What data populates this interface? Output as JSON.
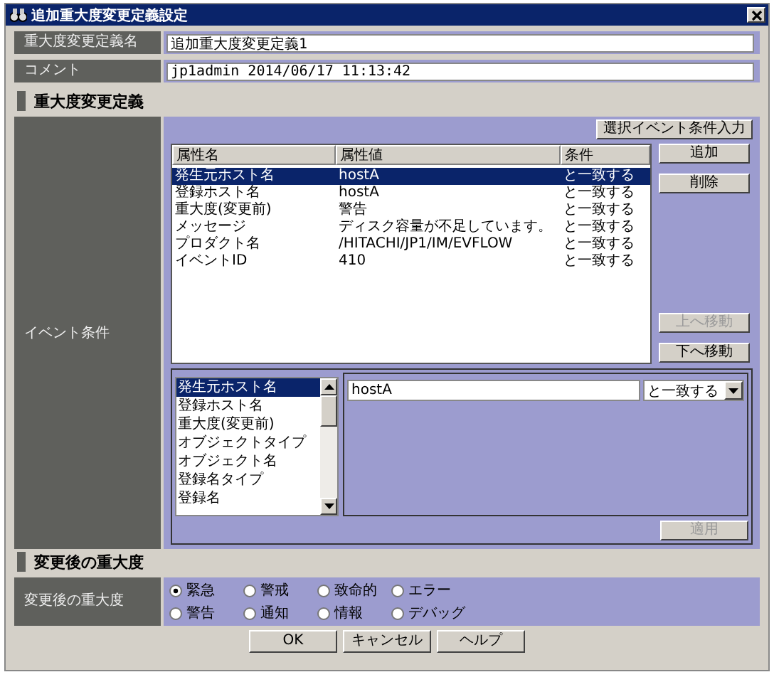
{
  "window": {
    "title": "追加重大度変更定義設定"
  },
  "fields": [
    {
      "label": "重大度変更定義名",
      "value": "追加重大度変更定義1"
    },
    {
      "label": "コメント",
      "value": "jp1admin 2014/06/17 11:13:42"
    }
  ],
  "definition_section": {
    "heading": "重大度変更定義",
    "label": "イベント条件",
    "input_button": "選択イベント条件入力",
    "table": {
      "columns": [
        "属性名",
        "属性値",
        "条件"
      ],
      "rows": [
        {
          "cells": [
            "発生元ホスト名",
            "hostA",
            "と一致する"
          ],
          "selected": true
        },
        {
          "cells": [
            "登録ホスト名",
            "hostA",
            "と一致する"
          ],
          "selected": false
        },
        {
          "cells": [
            "重大度(変更前)",
            "警告",
            "と一致する"
          ],
          "selected": false
        },
        {
          "cells": [
            "メッセージ",
            "ディスク容量が不足しています。",
            "と一致する"
          ],
          "selected": false
        },
        {
          "cells": [
            "プロダクト名",
            "/HITACHI/JP1/IM/EVFLOW",
            "と一致する"
          ],
          "selected": false
        },
        {
          "cells": [
            "イベントID",
            "410",
            "と一致する"
          ],
          "selected": false
        }
      ]
    },
    "side_buttons": [
      {
        "label": "追加",
        "disabled": false
      },
      {
        "label": "削除",
        "disabled": false
      },
      {
        "label": "上へ移動",
        "disabled": true
      },
      {
        "label": "下へ移動",
        "disabled": false
      }
    ],
    "attribute_list": {
      "items": [
        {
          "label": "発生元ホスト名",
          "selected": true
        },
        {
          "label": "登録ホスト名",
          "selected": false
        },
        {
          "label": "重大度(変更前)",
          "selected": false
        },
        {
          "label": "オブジェクトタイプ",
          "selected": false
        },
        {
          "label": "オブジェクト名",
          "selected": false
        },
        {
          "label": "登録名タイプ",
          "selected": false
        },
        {
          "label": "登録名",
          "selected": false
        }
      ]
    },
    "value_field": {
      "value": "hostA"
    },
    "condition_select": {
      "value": "と一致する"
    },
    "apply_button": {
      "label": "適用",
      "disabled": true
    }
  },
  "severity_section": {
    "heading": "変更後の重大度",
    "label": "変更後の重大度",
    "options": [
      {
        "label": "緊急",
        "selected": true
      },
      {
        "label": "警戒",
        "selected": false
      },
      {
        "label": "致命的",
        "selected": false
      },
      {
        "label": "エラー",
        "selected": false
      },
      {
        "label": "警告",
        "selected": false
      },
      {
        "label": "通知",
        "selected": false
      },
      {
        "label": "情報",
        "selected": false
      },
      {
        "label": "デバッグ",
        "selected": false
      }
    ]
  },
  "buttons": [
    "OK",
    "キャンセル",
    "ヘルプ"
  ]
}
